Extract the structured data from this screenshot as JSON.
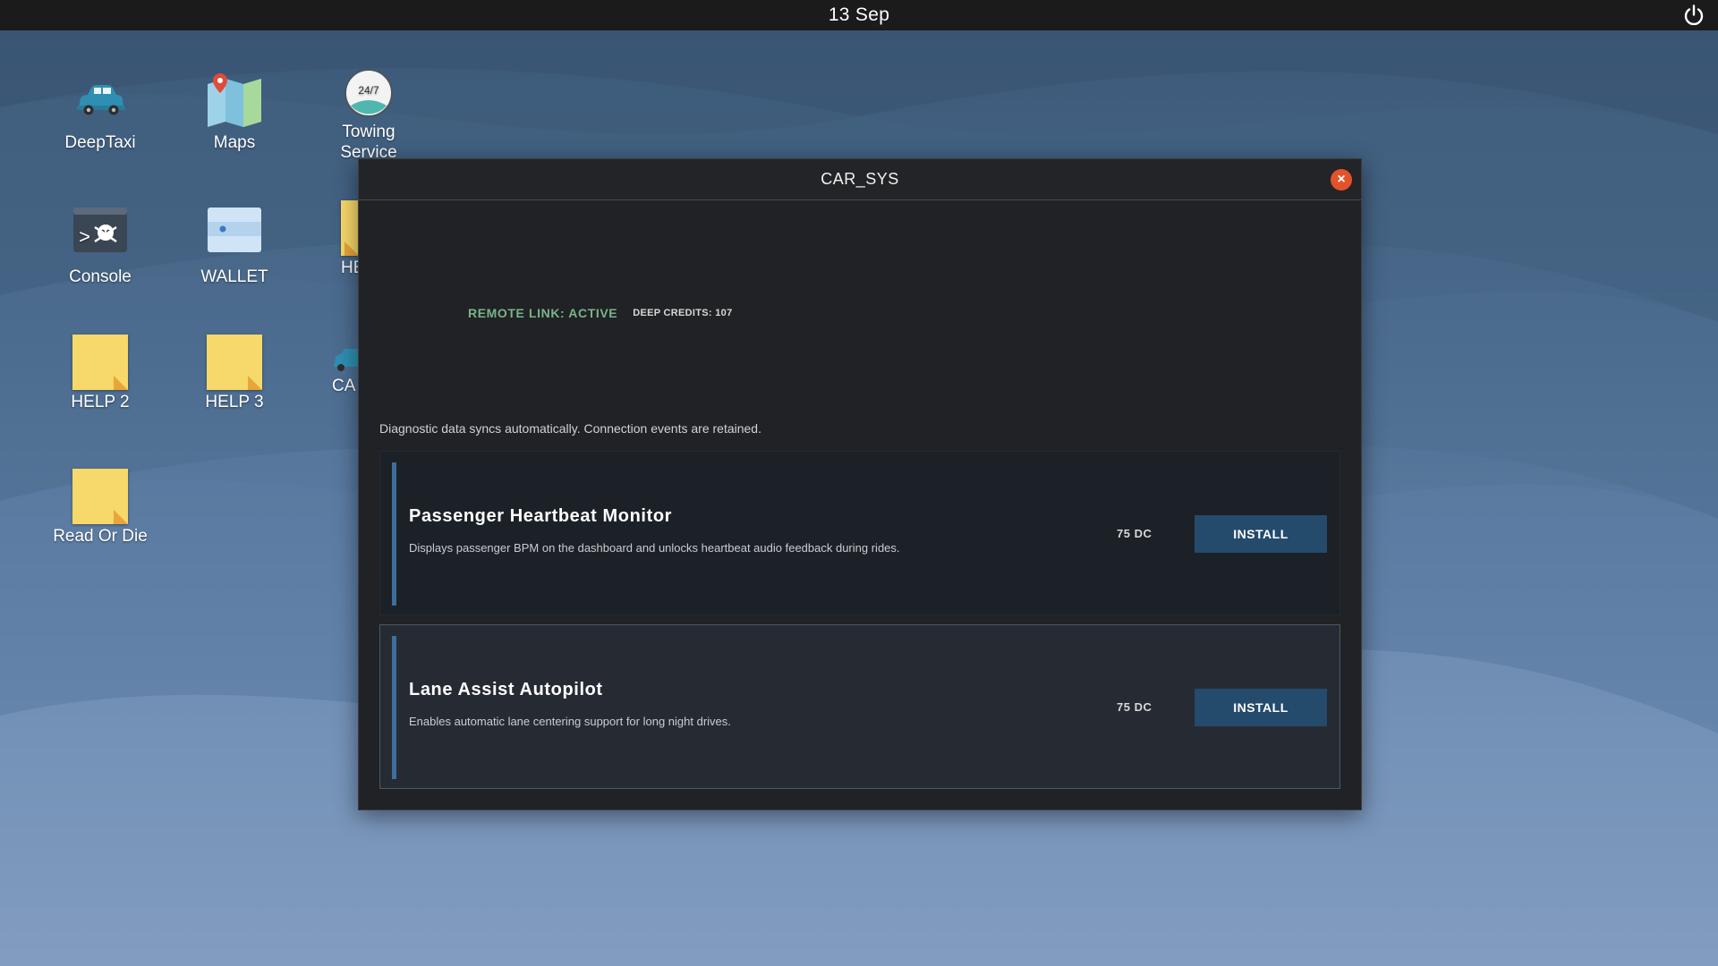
{
  "topbar": {
    "date": "13 Sep",
    "power_icon": "power-icon"
  },
  "desktop": {
    "icons": [
      {
        "label": "DeepTaxi",
        "icon": "taxi-car-icon"
      },
      {
        "label": "Maps",
        "icon": "map-icon"
      },
      {
        "label": "Towing Service",
        "icon": "clock-24-7-icon"
      },
      {
        "label": "Console",
        "icon": "console-skull-icon"
      },
      {
        "label": "WALLET",
        "icon": "wallet-icon"
      },
      {
        "label": "HE",
        "icon": "note-icon"
      },
      {
        "label": "HELP 2",
        "icon": "note-icon"
      },
      {
        "label": "HELP 3",
        "icon": "note-icon"
      },
      {
        "label": "CA",
        "icon": "car-icon"
      },
      {
        "label": "Read Or Die",
        "icon": "note-icon"
      }
    ]
  },
  "window": {
    "title": "CAR_SYS",
    "link_status": "REMOTE LINK: ACTIVE",
    "credits": "DEEP CREDITS: 107",
    "sync_note": "Diagnostic data syncs automatically. Connection events are retained.",
    "modules": [
      {
        "name": "Passenger Heartbeat Monitor",
        "description": "Displays passenger BPM on the dashboard and unlocks heartbeat audio feedback during rides.",
        "price": "75 DC",
        "action": "INSTALL"
      },
      {
        "name": "Lane Assist Autopilot",
        "description": "Enables automatic lane centering support for long night drives.",
        "price": "75 DC",
        "action": "INSTALL"
      }
    ]
  },
  "colors": {
    "accent": "#3d6f9e",
    "close": "#e2532b",
    "status_green": "#7ab38a",
    "button": "#244a6c"
  }
}
